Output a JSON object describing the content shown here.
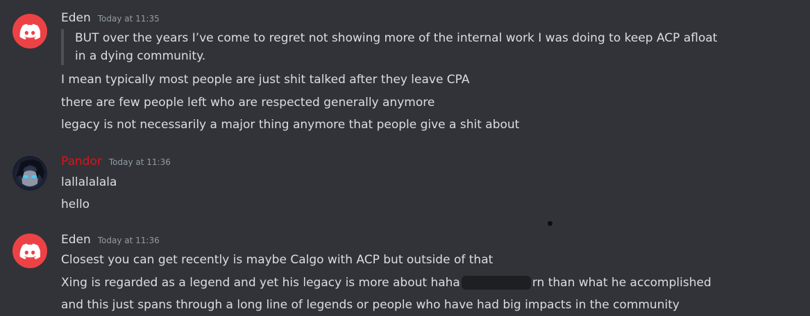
{
  "messages": [
    {
      "username": "Eden",
      "timestamp": "Today at 11:35",
      "quote": [
        "BUT over the years I’ve come to regret not showing more of the internal work I was doing to keep ACP afloat",
        "in a dying community."
      ],
      "lines": [
        "I mean typically most people are just shit talked after they leave CPA",
        "there are few people left who are respected generally anymore",
        "legacy is not necessarily a major thing anymore that people give a shit about"
      ]
    },
    {
      "username": "Pandor",
      "username_color": "#e0121b",
      "timestamp": "Today at 11:36",
      "lines": [
        "lallalalala",
        "hello"
      ]
    },
    {
      "username": "Eden",
      "timestamp": "Today at 11:36",
      "lines": [
        "Closest you can get recently is maybe Calgo with ACP but outside of that",
        "Xing is regarded as a legend and yet his legacy is more about haha",
        "rn than what he accomplished",
        "and this just spans through a long line of legends or people who have had big impacts in the community"
      ]
    }
  ],
  "colors": {
    "background": "#313338",
    "discord_avatar": "#ed4245",
    "text": "#dbdee1",
    "muted": "#949ba4"
  },
  "icons": {
    "discord_avatar": "discord-logo-icon",
    "user_avatar": "anime-character-avatar"
  }
}
